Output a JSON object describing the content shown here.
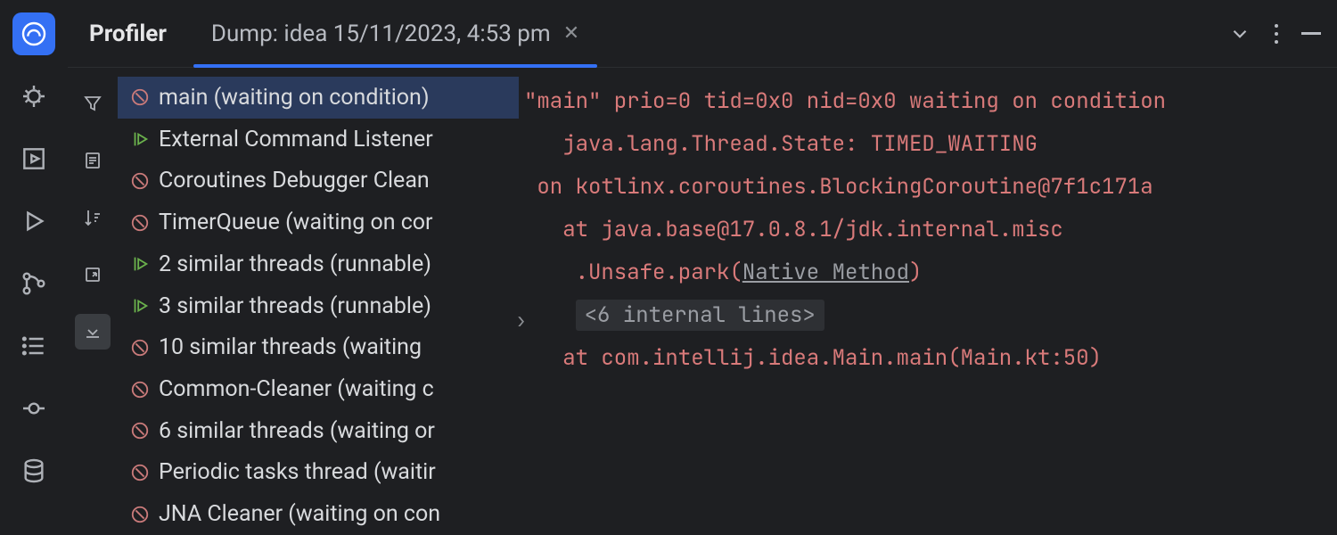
{
  "activity_bar": {
    "items": [
      "profiler",
      "debug",
      "services",
      "run",
      "vcs",
      "todo",
      "commit",
      "database"
    ]
  },
  "tabbar": {
    "title": "Profiler",
    "tab_label": "Dump: idea 15/11/2023, 4:53 pm"
  },
  "toolstrip": {
    "items": [
      "filter",
      "details",
      "sort",
      "export",
      "close"
    ]
  },
  "threads": [
    {
      "state": "waiting",
      "label": "main (waiting on condition)",
      "selected": true
    },
    {
      "state": "runnable",
      "label": "External Command Listener"
    },
    {
      "state": "waiting",
      "label": "Coroutines Debugger Clean"
    },
    {
      "state": "waiting",
      "label": "TimerQueue (waiting on cor"
    },
    {
      "state": "runnable",
      "label": "2 similar threads (runnable)"
    },
    {
      "state": "runnable",
      "label": "3 similar threads (runnable)"
    },
    {
      "state": "waiting",
      "label": "10 similar threads (waiting "
    },
    {
      "state": "waiting",
      "label": "Common-Cleaner (waiting c"
    },
    {
      "state": "waiting",
      "label": "6 similar threads (waiting or"
    },
    {
      "state": "waiting",
      "label": "Periodic tasks thread (waitir"
    },
    {
      "state": "waiting",
      "label": "JNA Cleaner (waiting on con"
    }
  ],
  "trace": {
    "line1": "\"main\" prio=0 tid=0x0 nid=0x0 waiting on condition",
    "line2": "   java.lang.Thread.State: TIMED_WAITING",
    "line3": " on kotlinx.coroutines.BlockingCoroutine@7f1c171a",
    "line4_pre": "   at java.base@17.0.8.1/jdk.internal.misc",
    "line5_pre": "    .Unsafe.park(",
    "line5_link": "Native Method",
    "line5_post": ")",
    "folded": "<6 internal lines>",
    "line7": "   at com.intellij.idea.Main.main(Main.kt:50)"
  }
}
